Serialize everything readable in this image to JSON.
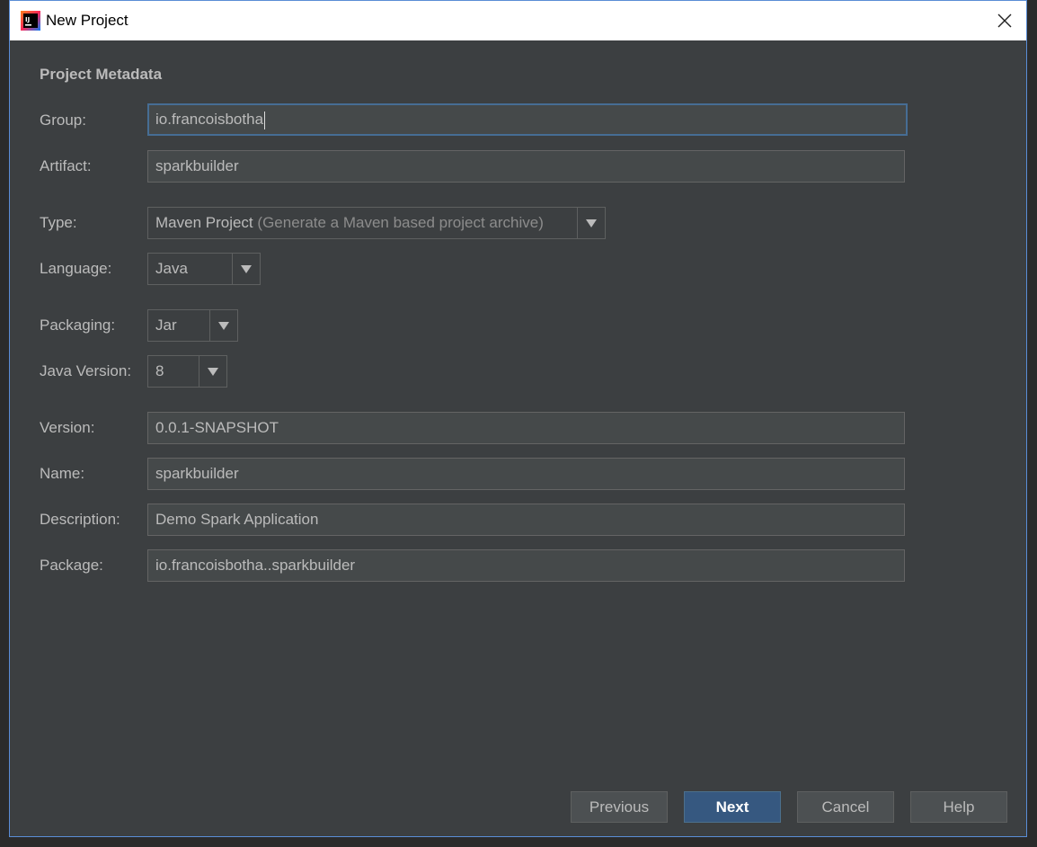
{
  "window": {
    "title": "New Project"
  },
  "section_title": "Project Metadata",
  "fields": {
    "group": {
      "label": "Group:",
      "value": "io.francoisbotha"
    },
    "artifact": {
      "label": "Artifact:",
      "value": "sparkbuilder"
    },
    "type": {
      "label": "Type:",
      "value": "Maven Project",
      "hint": "(Generate a Maven based project archive)"
    },
    "language": {
      "label": "Language:",
      "value": "Java"
    },
    "packaging": {
      "label": "Packaging:",
      "value": "Jar"
    },
    "java_version": {
      "label": "Java Version:",
      "value": "8"
    },
    "version": {
      "label": "Version:",
      "value": "0.0.1-SNAPSHOT"
    },
    "name": {
      "label": "Name:",
      "value": "sparkbuilder"
    },
    "description": {
      "label": "Description:",
      "value": "Demo Spark Application"
    },
    "package": {
      "label": "Package:",
      "value": "io.francoisbotha..sparkbuilder"
    }
  },
  "buttons": {
    "previous": "Previous",
    "next": "Next",
    "cancel": "Cancel",
    "help": "Help"
  },
  "colors": {
    "background": "#3c3f41",
    "field_bg": "#45494a",
    "focus_border": "#466d94",
    "primary_button": "#365880",
    "text": "#bbbbbb"
  },
  "icons": {
    "app": "intellij-idea-icon",
    "close": "close-icon",
    "dropdown": "chevron-down-icon"
  }
}
